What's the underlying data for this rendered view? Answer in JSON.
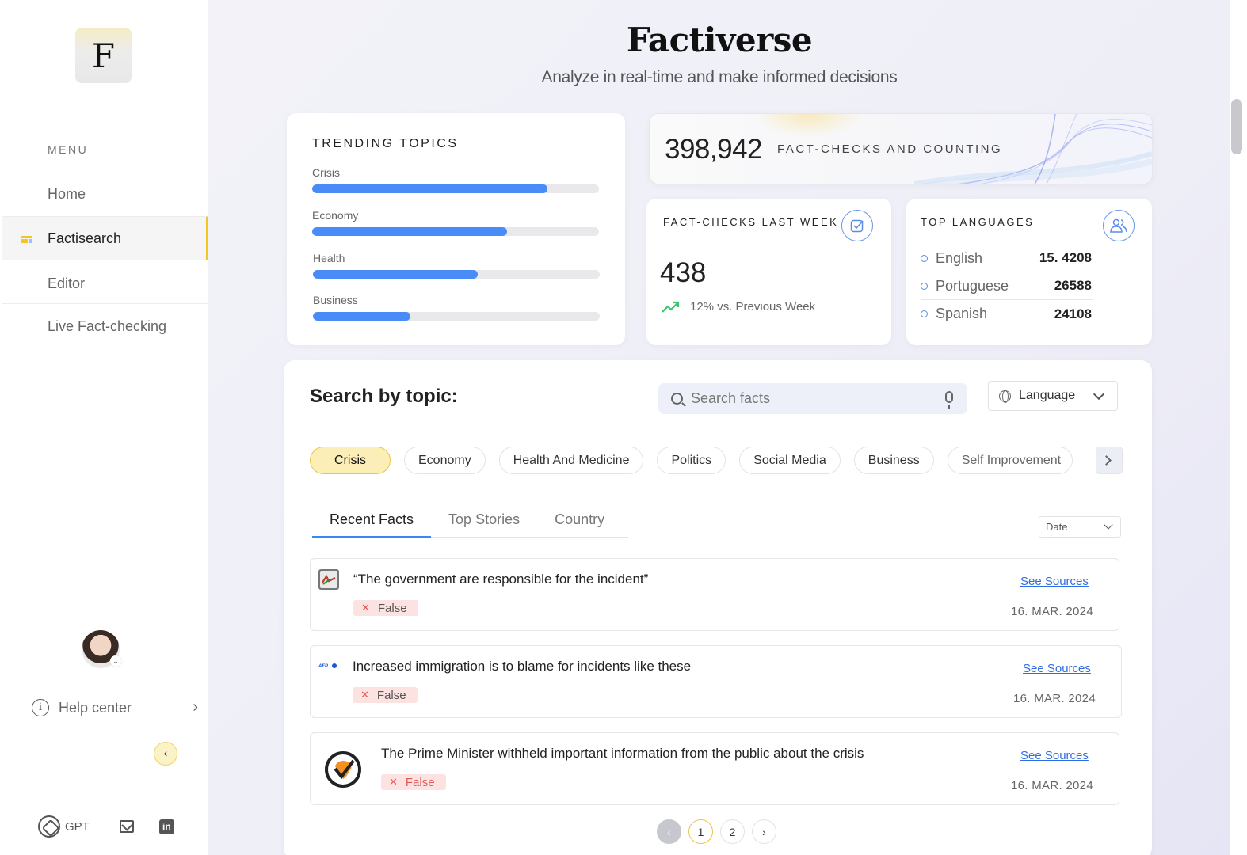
{
  "sidebar": {
    "logo_letter": "F",
    "menu_label": "MENU",
    "items": [
      {
        "label": "Home"
      },
      {
        "label": "Factisearch"
      },
      {
        "label": "Editor"
      },
      {
        "label": "Live Fact-checking"
      }
    ],
    "help_label": "Help center",
    "footer": {
      "gpt_label": "GPT",
      "linkedin_label": "in"
    }
  },
  "header": {
    "title": "Factiverse",
    "subtitle": "Analyze in real-time and make informed decisions"
  },
  "trending": {
    "heading": "TRENDING TOPICS",
    "topics": [
      {
        "label": "Crisis",
        "fill": 0.82
      },
      {
        "label": "Economy",
        "fill": 0.68
      },
      {
        "label": "Health",
        "fill": 0.575
      },
      {
        "label": "Business",
        "fill": 0.34
      }
    ]
  },
  "counter": {
    "value": "398,942",
    "caption": "FACT-CHECKS AND COUNTING"
  },
  "last_week": {
    "heading": "FACT-CHECKS LAST WEEK",
    "value": "438",
    "trend_text": "12% vs. Previous Week"
  },
  "languages": {
    "heading": "TOP LANGUAGES",
    "rows": [
      {
        "name": "English",
        "count": "15. 4208"
      },
      {
        "name": "Portuguese",
        "count": "26588"
      },
      {
        "name": "Spanish",
        "count": "24108"
      }
    ]
  },
  "search": {
    "title": "Search by topic:",
    "placeholder": "Search facts",
    "language_label": "Language",
    "chips": [
      {
        "label": "Crisis"
      },
      {
        "label": "Economy"
      },
      {
        "label": "Health And Medicine"
      },
      {
        "label": "Politics"
      },
      {
        "label": "Social Media"
      },
      {
        "label": "Business"
      },
      {
        "label": "Self Improvement"
      }
    ],
    "tabs": [
      {
        "label": "Recent Facts"
      },
      {
        "label": "Top Stories"
      },
      {
        "label": "Country"
      }
    ],
    "sort_label": "Date"
  },
  "facts": [
    {
      "claim": "“The government are responsible for the incident”",
      "verdict": "False",
      "sources_label": "See Sources",
      "date": "16. MAR. 2024"
    },
    {
      "claim": "Increased immigration is to blame for incidents like these",
      "verdict": "False",
      "sources_label": "See Sources",
      "date": "16. MAR. 2024"
    },
    {
      "claim": "The Prime Minister withheld important information from the public about the crisis",
      "verdict": "False",
      "sources_label": "See Sources",
      "date": "16. MAR. 2024"
    }
  ],
  "pagination": {
    "pages": [
      "1",
      "2"
    ],
    "current": "1"
  },
  "colors": {
    "accent_blue": "#4a8cf7",
    "accent_yellow": "#f3c623",
    "false_badge": "#fde2e2",
    "trend_green": "#3cc46a"
  }
}
